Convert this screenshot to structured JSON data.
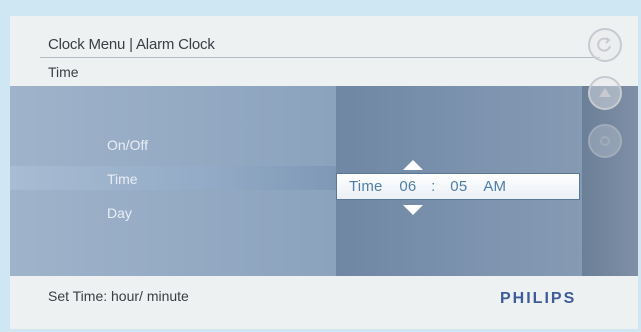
{
  "header": {
    "breadcrumb": "Clock Menu | Alarm Clock",
    "subtitle": "Time"
  },
  "menu": {
    "items": [
      {
        "label": "On/Off"
      },
      {
        "label": "Time"
      },
      {
        "label": "Day"
      }
    ],
    "selected": "Time"
  },
  "time_setting": {
    "label": "Time",
    "hour": "06",
    "separator": ":",
    "minute": "05",
    "period": "AM"
  },
  "side_buttons": {
    "icons": [
      "back-icon",
      "up-icon",
      "gear-icon"
    ]
  },
  "footer": {
    "hint": "Set Time: hour/ minute",
    "brand": "PHILIPS"
  },
  "colors": {
    "brand": "#3e5c9a",
    "time_text": "#4f7fa9",
    "panel": "#8ea5bf"
  }
}
